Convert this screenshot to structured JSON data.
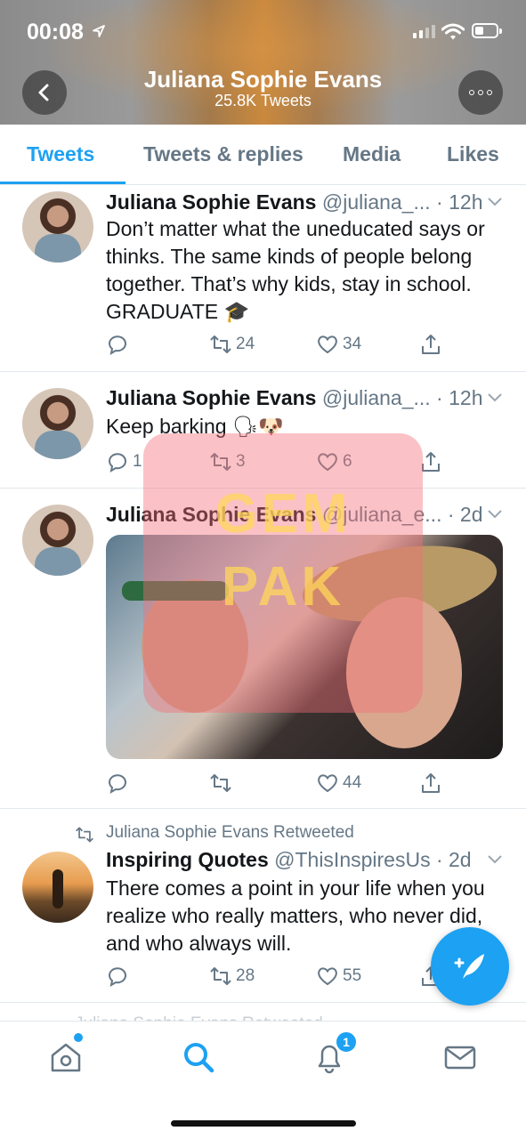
{
  "status_bar": {
    "time": "00:08"
  },
  "header": {
    "title": "Juliana Sophie Evans",
    "subtitle": "25.8K Tweets"
  },
  "tabs": [
    {
      "label": "Tweets",
      "active": true
    },
    {
      "label": "Tweets & replies"
    },
    {
      "label": "Media"
    },
    {
      "label": "Likes"
    }
  ],
  "tweets": [
    {
      "name": "Juliana Sophie Evans",
      "meta": "@juliana_... · 12h",
      "text": "Don’t matter what the uneducated says or thinks. The same kinds of people belong together. That’s why kids, stay in school. GRADUATE 🎓",
      "replies": "",
      "retweets": "24",
      "likes": "34"
    },
    {
      "name": "Juliana Sophie Evans",
      "meta": "@juliana_... · 12h",
      "text": "Keep barking 🗣🐶",
      "replies": "1",
      "retweets": "3",
      "likes": "6"
    },
    {
      "name": "Juliana Sophie Evans",
      "meta": "@juliana_e... · 2d",
      "text": "",
      "replies": "",
      "retweets": "",
      "likes": "44"
    },
    {
      "retweeted_label": "Juliana Sophie Evans Retweeted",
      "name": "Inspiring Quotes",
      "meta": "@ThisInspiresUs · 2d",
      "text": "There comes a point in your life when you realize who really matters, who never did, and who always will.",
      "replies": "",
      "retweets": "28",
      "likes": "55"
    }
  ],
  "peek_text": "Juliana Sophie Evans Retweeted",
  "watermark": {
    "line1": "GEM",
    "line2": "PAK"
  },
  "bottom_nav": {
    "notification_count": "1"
  },
  "colors": {
    "accent": "#1da1f2",
    "muted": "#657786",
    "text": "#14171a",
    "divider": "#e1e8ed"
  }
}
